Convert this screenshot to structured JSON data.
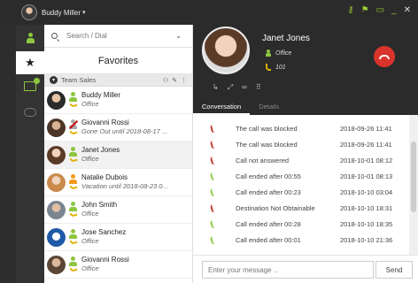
{
  "titlebar": {
    "user_name": "Buddy Miller",
    "caret": "▾",
    "icons": [
      "key-icon",
      "flag-icon",
      "window-icon",
      "minimize-icon",
      "close-icon"
    ]
  },
  "rail": {
    "items": [
      "contacts-icon",
      "star-icon",
      "board-icon",
      "cloud-icon"
    ],
    "badge": "1"
  },
  "search": {
    "placeholder": "Search / Dial"
  },
  "favorites": {
    "label": "Favorites"
  },
  "group": {
    "name": "Team Sales",
    "toggle": "▾"
  },
  "contacts": [
    {
      "name": "Buddy Miller",
      "status": "Office",
      "color": "green"
    },
    {
      "name": "Giovanni Rossi",
      "status": "Gone Out until 2018-08-17 ...",
      "color": "gray"
    },
    {
      "name": "Janet Jones",
      "status": "Office",
      "color": "green"
    },
    {
      "name": "Natalie Dubois",
      "status": "Vacation until 2018-08-23 0...",
      "color": "orange"
    },
    {
      "name": "John Smith",
      "status": "Office",
      "color": "green"
    },
    {
      "name": "Jose Sanchez",
      "status": "Office",
      "color": "green"
    },
    {
      "name": "Giovanni Rossi",
      "status": "Office",
      "color": "green"
    }
  ],
  "detail": {
    "name": "Janet Jones",
    "location": "Office",
    "extension": "101",
    "tabs": [
      "Conversation",
      "Details"
    ],
    "actions": [
      "↳",
      "⤢",
      "∞",
      "⠿"
    ]
  },
  "calllog": [
    {
      "text": "The call was blocked",
      "date": "2018-09-26 11:41",
      "type": "red"
    },
    {
      "text": "The call was blocked",
      "date": "2018-09-26 11:41",
      "type": "red"
    },
    {
      "text": "Call not answered",
      "date": "2018-10-01 08:12",
      "type": "red"
    },
    {
      "text": "Call ended after 00:55",
      "date": "2018-10-01 08:13",
      "type": "green"
    },
    {
      "text": "Call ended after 00:23",
      "date": "2018-10-10 03:04",
      "type": "green"
    },
    {
      "text": "Destination Not Obtainable",
      "date": "2018-10-10 18:31",
      "type": "red"
    },
    {
      "text": "Call ended after 00:28",
      "date": "2018-10-10 18:35",
      "type": "green"
    },
    {
      "text": "Call ended after 00:01",
      "date": "2018-10-10 21:36",
      "type": "green"
    }
  ],
  "message": {
    "placeholder": "Enter your message ..",
    "send_label": "Send"
  },
  "colors": {
    "accent": "#8dc63f",
    "hangup": "#d9342b",
    "dark": "#2b2b2b"
  }
}
